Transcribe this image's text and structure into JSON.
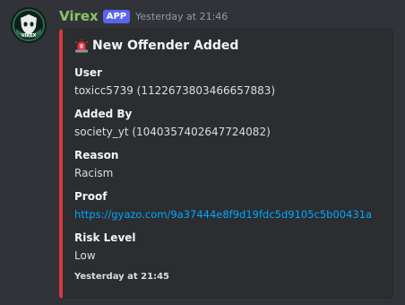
{
  "message": {
    "author": "Virex",
    "badge": "APP",
    "timestamp": "Yesterday at 21:46",
    "avatar_text": "VIREX",
    "avatar_icon": "ghost-shield-icon"
  },
  "embed": {
    "accent_color": "#da373c",
    "title_icon": "rotating-light-icon",
    "title": "New Offender Added",
    "fields": [
      {
        "name": "User",
        "value": "toxicc5739 (1122673803466657883)"
      },
      {
        "name": "Added By",
        "value": "society_yt (1040357402647724082)"
      },
      {
        "name": "Reason",
        "value": "Racism"
      },
      {
        "name": "Proof",
        "value": "https://gyazo.com/9a37444e8f9d19fdc5d9105c5b00431a"
      },
      {
        "name": "Risk Level",
        "value": "Low"
      }
    ],
    "footer": "Yesterday at 21:45"
  }
}
